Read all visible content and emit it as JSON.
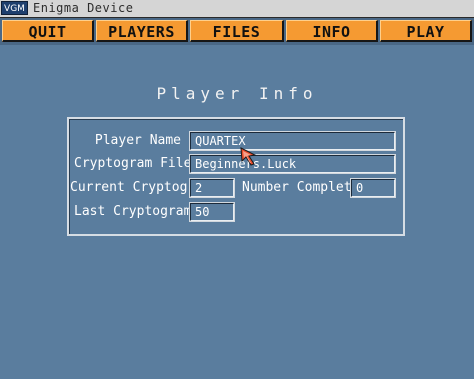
{
  "window": {
    "badge": "VGM",
    "title": "Enigma Device"
  },
  "menu": {
    "quit": "QUIT",
    "players": "PLAYERS",
    "files": "FILES",
    "info": "INFO",
    "play": "PLAY"
  },
  "panel": {
    "title": "Player Info",
    "player_name_label": "Player Name",
    "player_name_value": "QUARTEX",
    "cryptogram_file_label": "Cryptogram File",
    "cryptogram_file_value": "Beginners.Luck",
    "current_cryptogram_label": "Current Cryptogram",
    "current_cryptogram_value": "2",
    "number_completed_label": "Number Completed",
    "number_completed_value": "0",
    "last_cryptogram_label": "Last Cryptogram",
    "last_cryptogram_value": "50"
  },
  "colors": {
    "background": "#5a7d9e",
    "menu_button": "#f59a32",
    "pointer": "#e84c2b"
  },
  "icons": {
    "pointer": "mouse-pointer-icon"
  }
}
